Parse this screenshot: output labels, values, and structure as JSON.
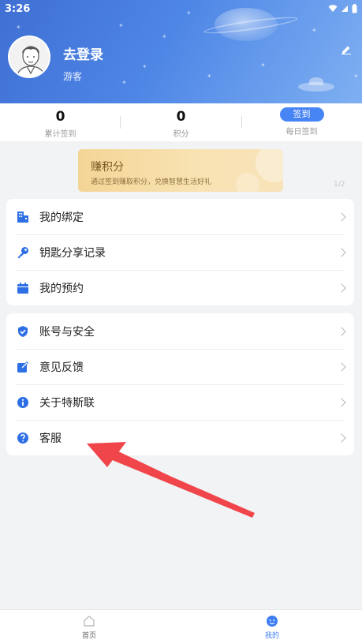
{
  "status_bar": {
    "time": "3:26",
    "icons": [
      "wifi-icon",
      "signal-icon",
      "battery-icon"
    ]
  },
  "profile": {
    "login_text": "去登录",
    "user_type": "游客",
    "edit_icon": "edit-pencil-icon"
  },
  "stats": [
    {
      "value": "0",
      "label": "累计签到"
    },
    {
      "value": "0",
      "label": "积分"
    }
  ],
  "signin": {
    "button_label": "签到",
    "label": "每日签到"
  },
  "banner": {
    "title": "赚积分",
    "subtitle": "通过签到赚取积分，兑换智慧生活好礼",
    "page_indicator": "1/2"
  },
  "menu_group_1": [
    {
      "label": "我的绑定",
      "icon": "building-icon"
    },
    {
      "label": "钥匙分享记录",
      "icon": "key-icon"
    },
    {
      "label": "我的预约",
      "icon": "calendar-icon"
    }
  ],
  "menu_group_2": [
    {
      "label": "账号与安全",
      "icon": "shield-check-icon"
    },
    {
      "label": "意见反馈",
      "icon": "feedback-edit-icon"
    },
    {
      "label": "关于特斯联",
      "icon": "info-icon"
    },
    {
      "label": "客服",
      "icon": "question-icon"
    }
  ],
  "tabbar": {
    "tabs": [
      {
        "label": "首页",
        "icon": "home-icon",
        "active": false
      },
      {
        "label": "我的",
        "icon": "profile-face-icon",
        "active": true
      }
    ]
  },
  "colors": {
    "accent": "#4784f4",
    "header_gradient_start": "#3f6fd3",
    "annotation_arrow": "#f0464b"
  }
}
